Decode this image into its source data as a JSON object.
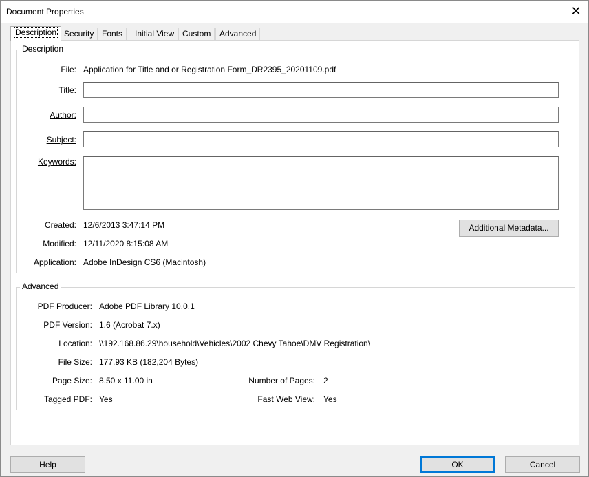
{
  "window": {
    "title": "Document Properties",
    "close_glyph": "✕"
  },
  "tabs": [
    {
      "label": "Description"
    },
    {
      "label": "Security"
    },
    {
      "label": "Fonts"
    },
    {
      "label": "Initial View"
    },
    {
      "label": "Custom"
    },
    {
      "label": "Advanced"
    }
  ],
  "description": {
    "group_label": "Description",
    "file_label": "File:",
    "file_value": "Application for Title and or Registration Form_DR2395_20201109.pdf",
    "title_label": "Title:",
    "title_value": "",
    "author_label": "Author:",
    "author_value": "",
    "subject_label": "Subject:",
    "subject_value": "",
    "keywords_label": "Keywords:",
    "keywords_value": "",
    "created_label": "Created:",
    "created_value": "12/6/2013 3:47:14 PM",
    "modified_label": "Modified:",
    "modified_value": "12/11/2020 8:15:08 AM",
    "application_label": "Application:",
    "application_value": "Adobe InDesign CS6 (Macintosh)",
    "metadata_button": "Additional Metadata..."
  },
  "advanced": {
    "group_label": "Advanced",
    "producer_label": "PDF Producer:",
    "producer_value": "Adobe PDF Library 10.0.1",
    "version_label": "PDF Version:",
    "version_value": "1.6 (Acrobat 7.x)",
    "location_label": "Location:",
    "location_value": "\\\\192.168.86.29\\household\\Vehicles\\2002 Chevy Tahoe\\DMV Registration\\",
    "filesize_label": "File Size:",
    "filesize_value": "177.93 KB (182,204 Bytes)",
    "pagesize_label": "Page Size:",
    "pagesize_value": "8.50 x 11.00 in",
    "pages_label": "Number of Pages:",
    "pages_value": "2",
    "tagged_label": "Tagged PDF:",
    "tagged_value": "Yes",
    "fastweb_label": "Fast Web View:",
    "fastweb_value": "Yes"
  },
  "footer": {
    "help_label": "Help",
    "ok_label": "OK",
    "cancel_label": "Cancel"
  }
}
